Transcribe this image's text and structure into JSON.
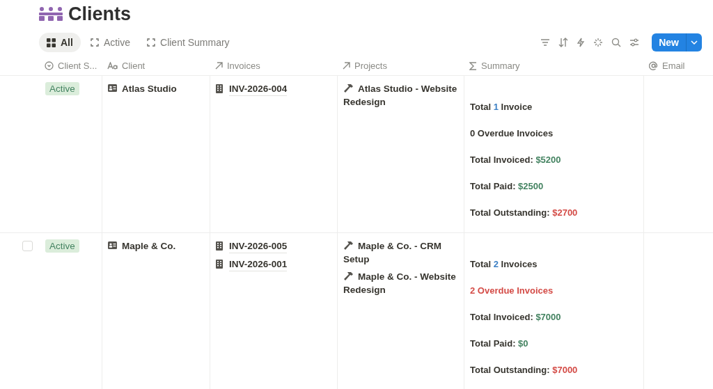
{
  "page": {
    "title": "Clients"
  },
  "views": [
    {
      "label": "All",
      "kind": "grid",
      "selected": true
    },
    {
      "label": "Active",
      "kind": "frame",
      "selected": false
    },
    {
      "label": "Client Summary",
      "kind": "frame",
      "selected": false
    }
  ],
  "toolbar": {
    "new_button": "New"
  },
  "table": {
    "columns": [
      {
        "label": "Client S...",
        "kind": "status"
      },
      {
        "label": "Client",
        "kind": "title"
      },
      {
        "label": "Invoices",
        "kind": "relation"
      },
      {
        "label": "Projects",
        "kind": "relation"
      },
      {
        "label": "Summary",
        "kind": "formula"
      },
      {
        "label": "Email",
        "kind": "email"
      }
    ],
    "rows": [
      {
        "hovered": false,
        "checked": false,
        "status": "Active",
        "client": "Atlas Studio",
        "invoices": [
          "INV-2026-004"
        ],
        "projects": [
          "Atlas Studio - Website Redesign"
        ],
        "summary": [
          [
            {
              "text": "Total ",
              "kind": "plain"
            },
            {
              "text": "1",
              "kind": "count"
            },
            {
              "text": " Invoice",
              "kind": "plain"
            }
          ],
          [
            {
              "text": "0 Overdue Invoices",
              "kind": "plain"
            }
          ],
          [
            {
              "text": "Total Invoiced: ",
              "kind": "plain"
            },
            {
              "text": "$5200",
              "kind": "good"
            }
          ],
          [
            {
              "text": "Total Paid: ",
              "kind": "plain"
            },
            {
              "text": "$2500",
              "kind": "good"
            }
          ],
          [
            {
              "text": "Total Outstanding: ",
              "kind": "plain"
            },
            {
              "text": "$2700",
              "kind": "bad"
            }
          ]
        ]
      },
      {
        "hovered": true,
        "checked": false,
        "status": "Active",
        "client": "Maple & Co.",
        "invoices": [
          "INV-2026-005",
          "INV-2026-001"
        ],
        "projects": [
          "Maple & Co. - CRM Setup",
          "Maple & Co. - Website Redesign"
        ],
        "summary": [
          [
            {
              "text": "Total ",
              "kind": "plain"
            },
            {
              "text": "2",
              "kind": "count"
            },
            {
              "text": " Invoices",
              "kind": "plain"
            }
          ],
          [
            {
              "text": "2 Overdue Invoices",
              "kind": "bad"
            }
          ],
          [
            {
              "text": "Total Invoiced: ",
              "kind": "plain"
            },
            {
              "text": "$7000",
              "kind": "good"
            }
          ],
          [
            {
              "text": "Total Paid: ",
              "kind": "plain"
            },
            {
              "text": "$0",
              "kind": "good"
            }
          ],
          [
            {
              "text": "Total Outstanding: ",
              "kind": "plain"
            },
            {
              "text": "$7000",
              "kind": "bad"
            }
          ]
        ]
      }
    ]
  }
}
